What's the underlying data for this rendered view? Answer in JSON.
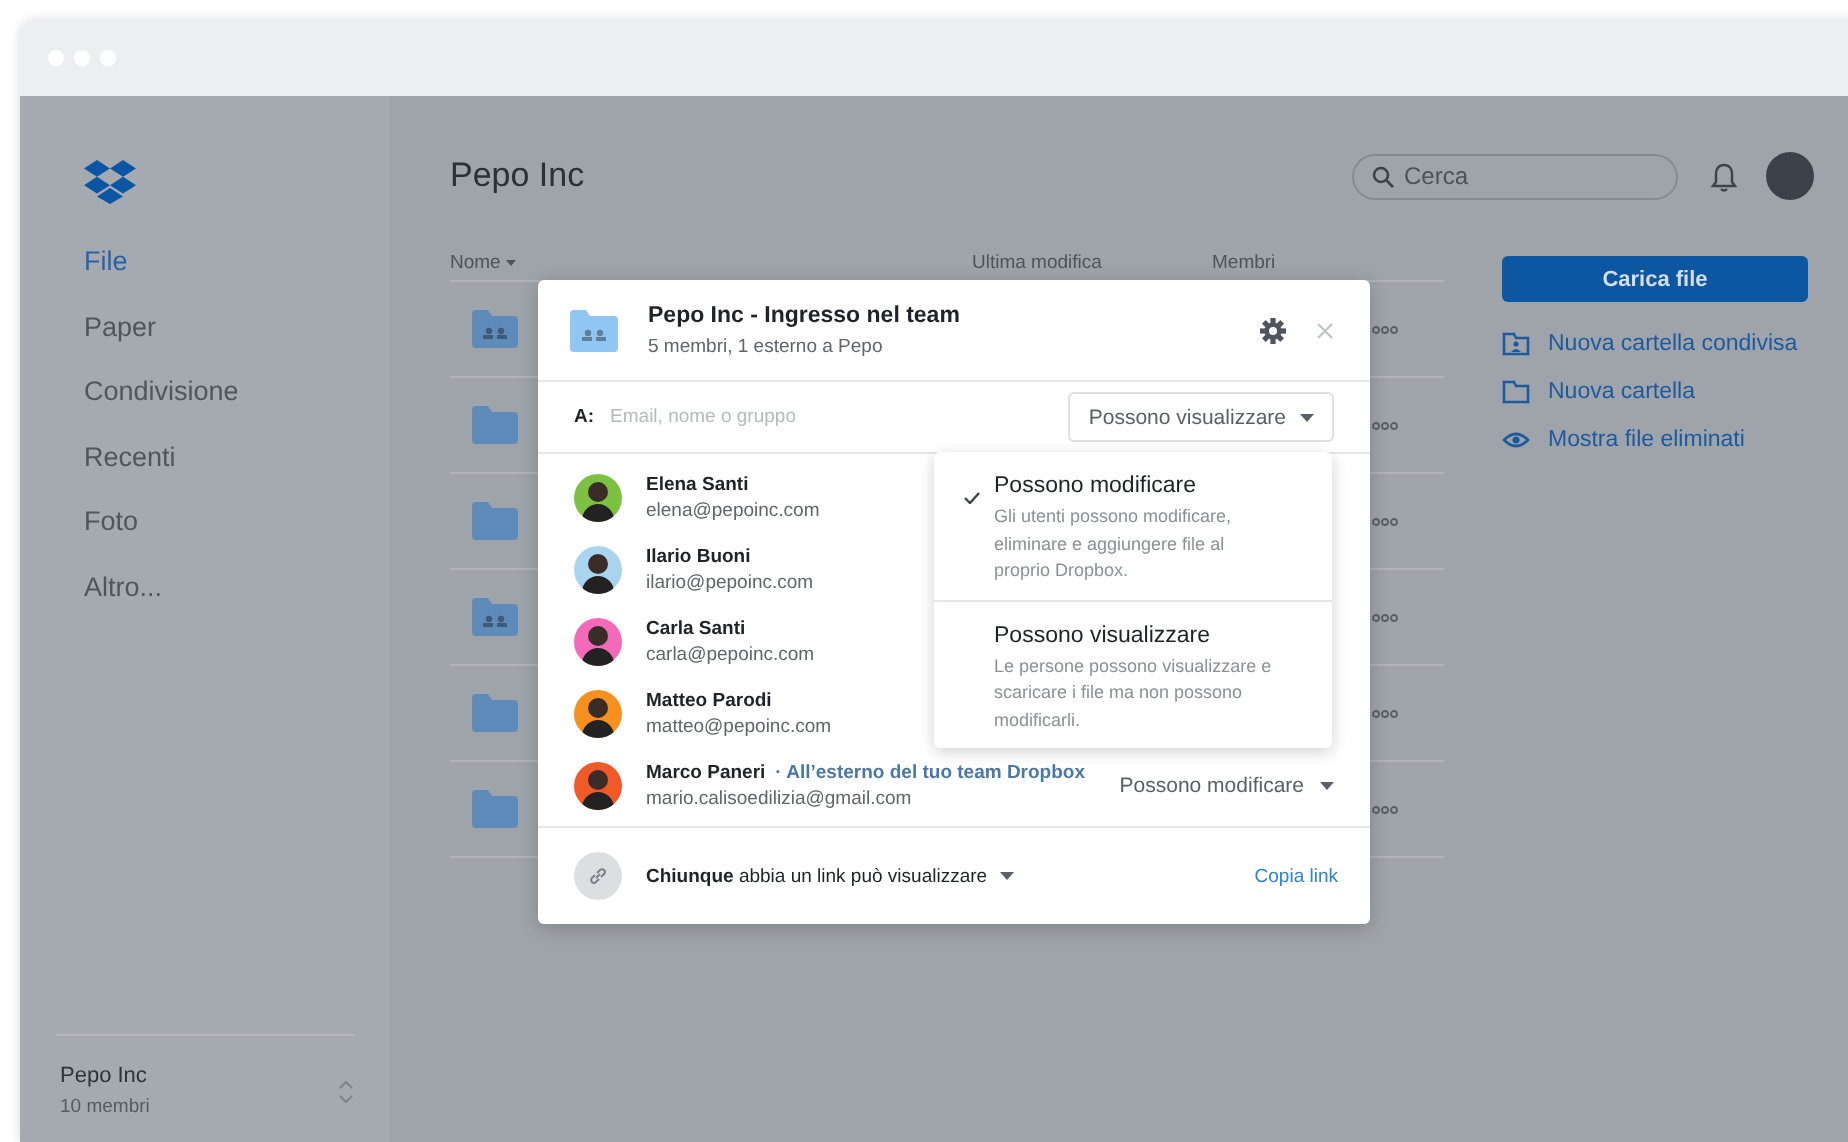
{
  "sidebar": {
    "items": [
      {
        "label": "File",
        "selected": true
      },
      {
        "label": "Paper",
        "selected": false
      },
      {
        "label": "Condivisione",
        "selected": false
      },
      {
        "label": "Recenti",
        "selected": false
      },
      {
        "label": "Foto",
        "selected": false
      },
      {
        "label": "Altro...",
        "selected": false
      }
    ],
    "team": {
      "name": "Pepo Inc",
      "members": "10 membri"
    }
  },
  "header": {
    "title": "Pepo Inc",
    "search": {
      "placeholder": "Cerca"
    }
  },
  "table": {
    "columns": [
      "Nome",
      "Ultima modifica",
      "Membri"
    ],
    "rows": [
      {
        "kind": "shared"
      },
      {
        "kind": "folder"
      },
      {
        "kind": "folder"
      },
      {
        "kind": "shared"
      },
      {
        "kind": "folder"
      },
      {
        "kind": "folder"
      }
    ]
  },
  "actions": {
    "upload": "Carica file",
    "links": [
      {
        "kind": "shared-folder",
        "label": "Nuova cartella condivisa"
      },
      {
        "kind": "folder",
        "label": "Nuova cartella"
      },
      {
        "kind": "eye",
        "label": "Mostra file eliminati"
      }
    ]
  },
  "dialog": {
    "title": "Pepo Inc - Ingresso nel team",
    "subtitle": "5 membri, 1 esterno a Pepo",
    "to_label": "A:",
    "to_placeholder": "Email, nome o gruppo",
    "permission": "Possono visualizzare",
    "members": [
      {
        "name": "Elena Santi",
        "email": "elena@pepoinc.com",
        "color": "#7cc142"
      },
      {
        "name": "Ilario Buoni",
        "email": "ilario@pepoinc.com",
        "color": "#a9d4f0"
      },
      {
        "name": "Carla Santi",
        "email": "carla@pepoinc.com",
        "color": "#f26ab8"
      },
      {
        "name": "Matteo Parodi",
        "email": "matteo@pepoinc.com",
        "color": "#f7901e"
      },
      {
        "name": "Marco Paneri",
        "note": "· All’esterno del tuo team Dropbox",
        "email": "mario.calisoedilizia@gmail.com",
        "role": "Possono modificare",
        "color": "#f05a28"
      }
    ],
    "link_text": "**Chiunque** abbia un link può visualizzare",
    "copy_link": "Copia link",
    "menu": [
      {
        "title": "Possono modificare",
        "description": "Gli utenti possono modificare, eliminare e aggiungere file al proprio Dropbox.",
        "selected": true
      },
      {
        "title": "Possono visualizzare",
        "description": "Le persone possono visualizzare e scaricare i file ma non possono modificarli.",
        "selected": false
      }
    ]
  }
}
